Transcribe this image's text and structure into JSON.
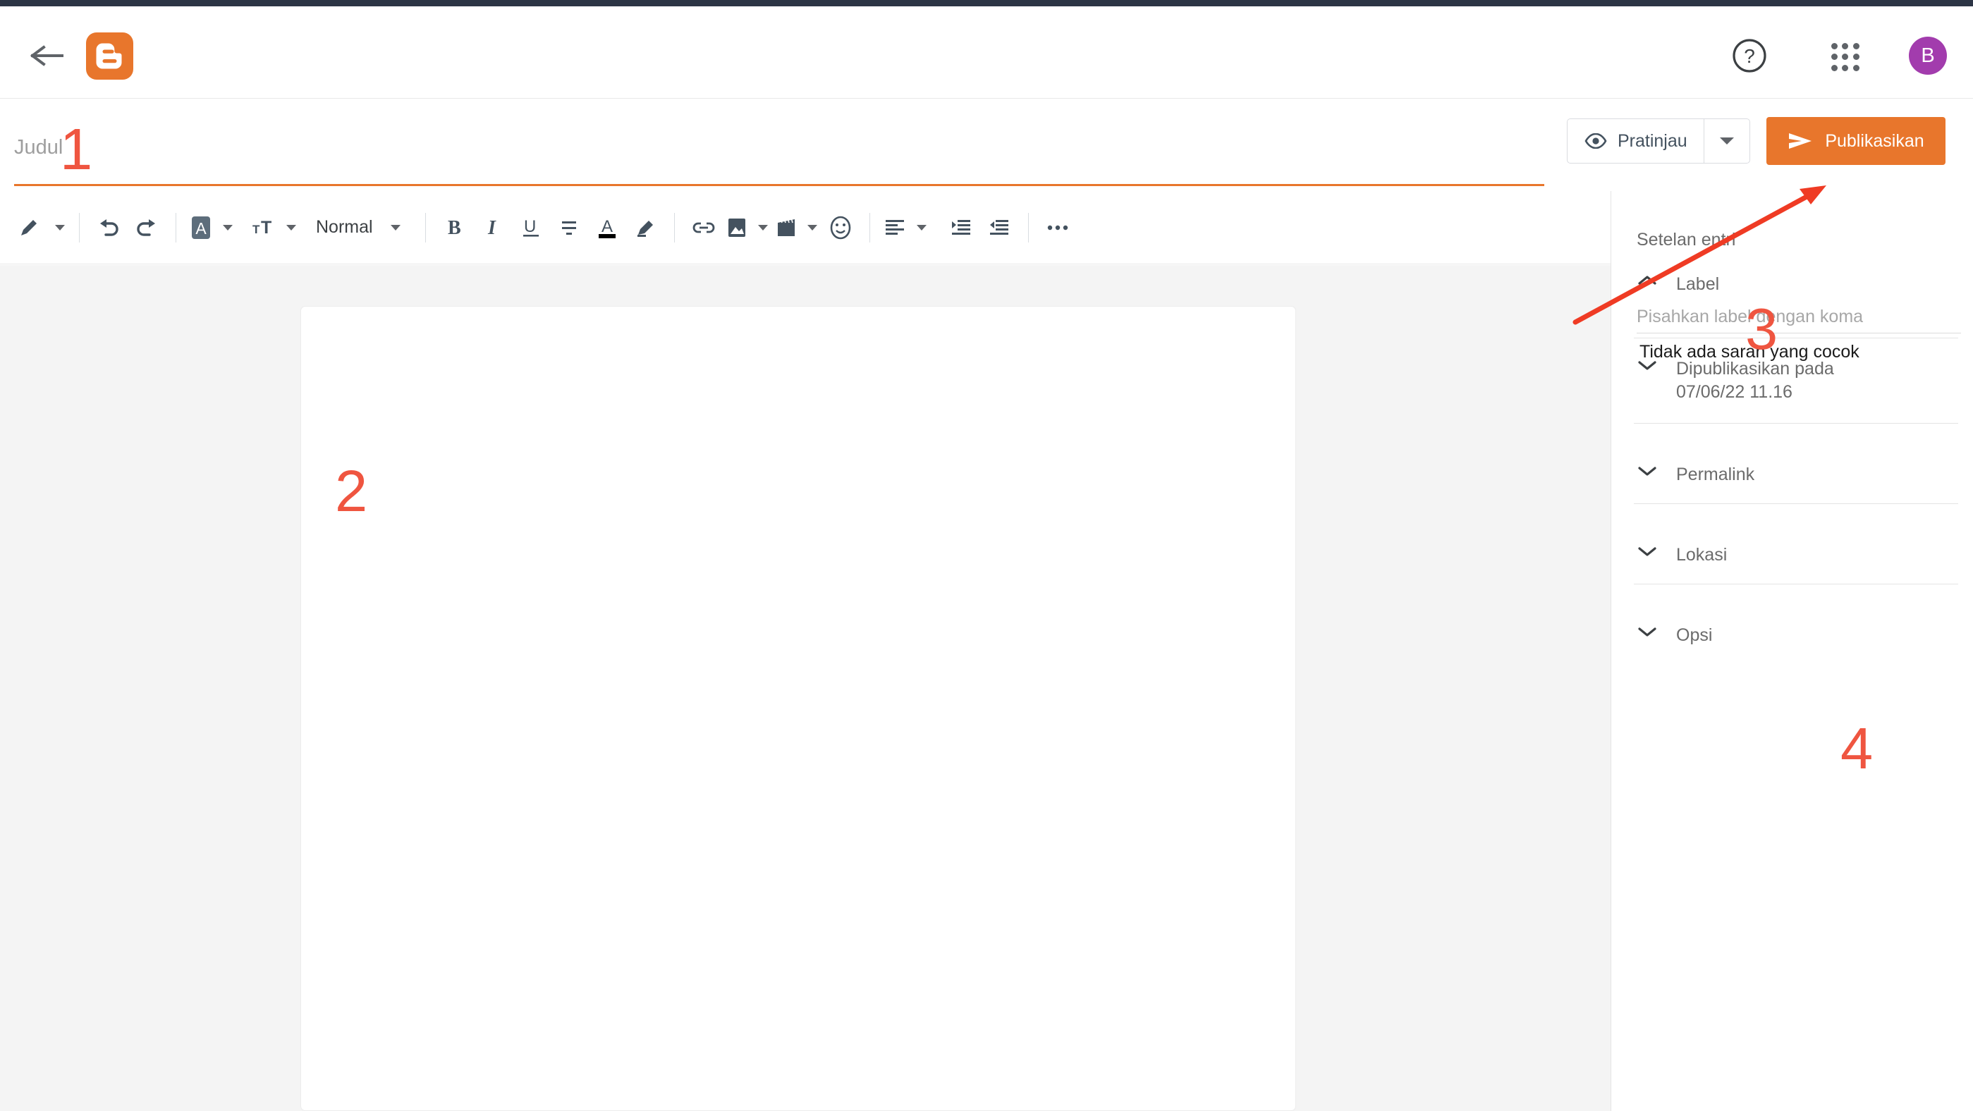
{
  "app": {
    "name": "Blogger",
    "logo_letter": "B",
    "accent_color": "#e8762c",
    "avatar_color": "#a23cad",
    "annotation_color": "#ef5540"
  },
  "header": {
    "back_label": "Kembali",
    "help_label": "Bantuan",
    "apps_label": "Aplikasi Google",
    "avatar_letter": "B"
  },
  "title": {
    "value": "",
    "placeholder": "Judul"
  },
  "actions": {
    "preview_label": "Pratinjau",
    "preview_caret_label": "Opsi pratinjau",
    "publish_label": "Publikasikan"
  },
  "toolbar": {
    "items": [
      {
        "name": "pen-icon",
        "label": "Pena",
        "caret": true
      },
      {
        "name": "undo-icon",
        "label": "Urungkan",
        "caret": false
      },
      {
        "name": "redo-icon",
        "label": "Ulangi",
        "caret": false
      },
      {
        "name": "font-icon",
        "label": "Font",
        "caret": true
      },
      {
        "name": "font-size-icon",
        "label": "Ukuran font",
        "caret": true
      },
      {
        "name": "paragraph-style",
        "label": "Normal",
        "caret": true
      },
      {
        "name": "bold-icon",
        "label": "Tebal",
        "caret": false
      },
      {
        "name": "italic-icon",
        "label": "Miring",
        "caret": false
      },
      {
        "name": "underline-icon",
        "label": "Garis bawah",
        "caret": false
      },
      {
        "name": "strikethrough-icon",
        "label": "Coret",
        "caret": false
      },
      {
        "name": "text-color-icon",
        "label": "Warna teks",
        "caret": false
      },
      {
        "name": "highlight-icon",
        "label": "Stabilo",
        "caret": false
      },
      {
        "name": "link-icon",
        "label": "Tautan",
        "caret": false
      },
      {
        "name": "image-icon",
        "label": "Gambar",
        "caret": true
      },
      {
        "name": "video-icon",
        "label": "Video",
        "caret": true
      },
      {
        "name": "emoji-icon",
        "label": "Emoji",
        "caret": false
      },
      {
        "name": "align-icon",
        "label": "Perataan",
        "caret": true
      },
      {
        "name": "indent-increase-icon",
        "label": "Tambah indentasi",
        "caret": false
      },
      {
        "name": "indent-decrease-icon",
        "label": "Kurangi indentasi",
        "caret": false
      },
      {
        "name": "more-icon",
        "label": "Lainnya",
        "caret": false
      }
    ],
    "paragraph_style": "Normal"
  },
  "editor": {
    "body_value": ""
  },
  "sidebar": {
    "title": "Setelan entri",
    "label_section": {
      "heading": "Label",
      "expanded": true,
      "input_value": "",
      "input_placeholder": "Pisahkan label dengan koma",
      "suggestion_text": "Tidak ada saran yang cocok"
    },
    "sections": [
      {
        "name": "published-on",
        "label": "Dipublikasikan pada",
        "value": "07/06/22 11.16",
        "expanded": false
      },
      {
        "name": "permalink",
        "label": "Permalink",
        "value": "",
        "expanded": false
      },
      {
        "name": "location",
        "label": "Lokasi",
        "value": "",
        "expanded": false
      },
      {
        "name": "options",
        "label": "Opsi",
        "value": "",
        "expanded": false
      }
    ]
  },
  "annotations": [
    {
      "name": "annotation-1",
      "text": "1"
    },
    {
      "name": "annotation-2",
      "text": "2"
    },
    {
      "name": "annotation-3",
      "text": "3"
    },
    {
      "name": "annotation-4",
      "text": "4"
    }
  ]
}
